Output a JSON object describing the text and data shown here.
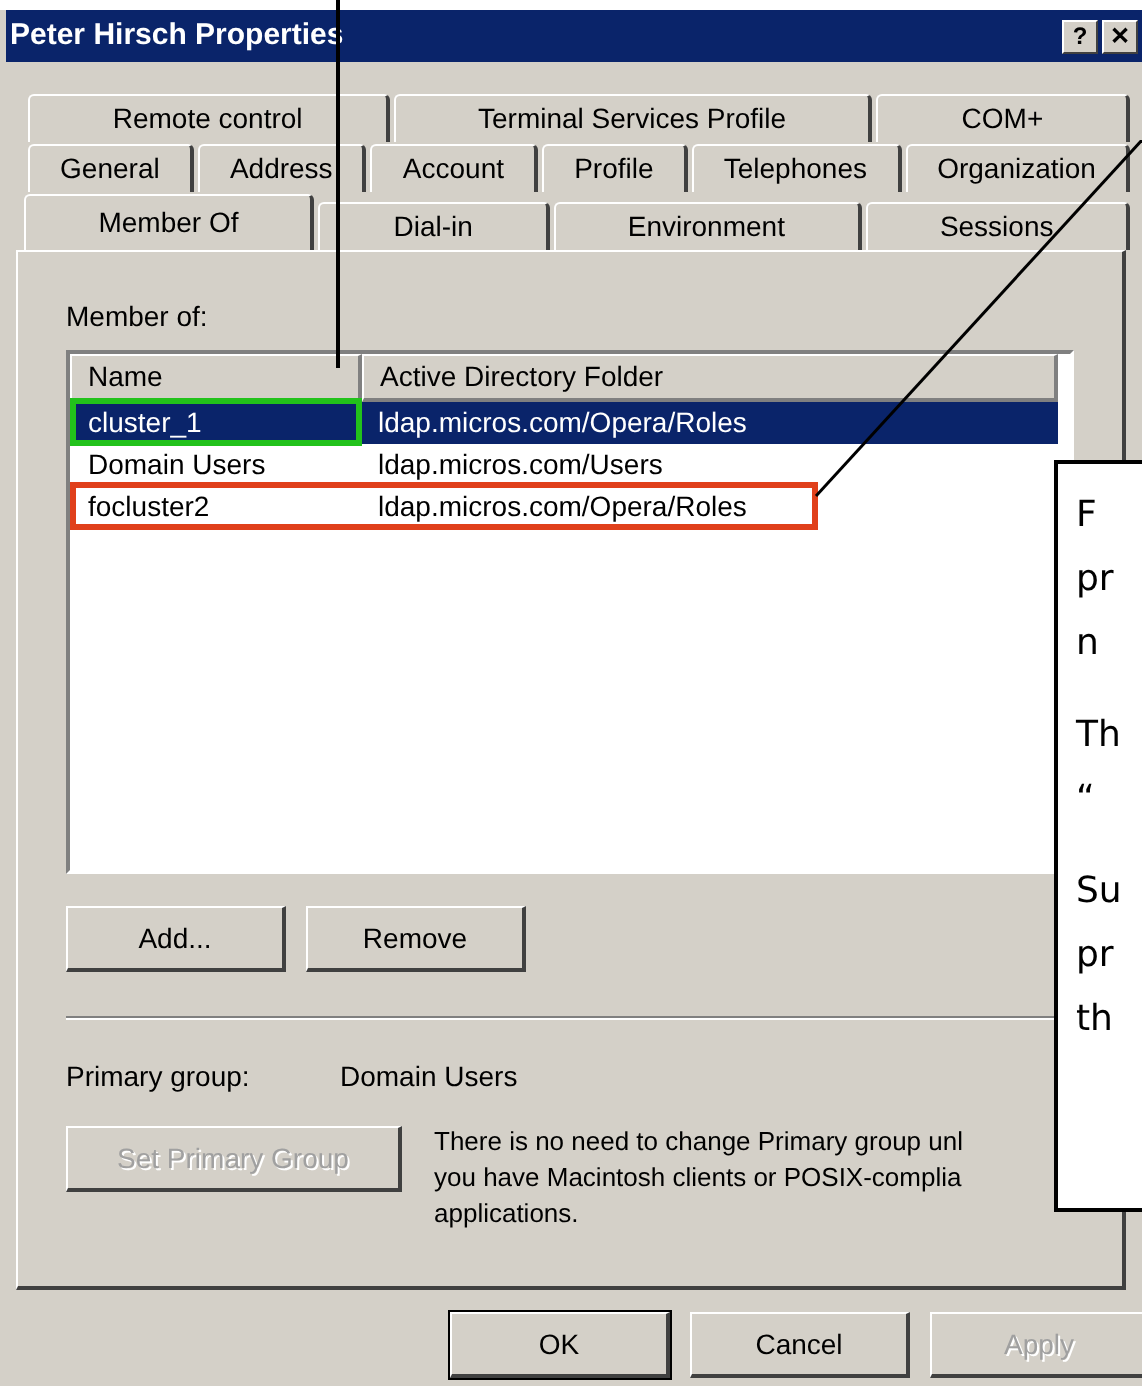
{
  "window": {
    "title": "Peter Hirsch Properties",
    "buttons": [
      "?",
      "✕"
    ]
  },
  "tab_rows": [
    [
      {
        "label": "Remote control",
        "selected": false
      },
      {
        "label": "Terminal Services Profile",
        "selected": false
      },
      {
        "label": "COM+",
        "selected": false
      }
    ],
    [
      {
        "label": "General",
        "selected": false
      },
      {
        "label": "Address",
        "selected": false
      },
      {
        "label": "Account",
        "selected": false
      },
      {
        "label": "Profile",
        "selected": false
      },
      {
        "label": "Telephones",
        "selected": false
      },
      {
        "label": "Organization",
        "selected": false
      }
    ],
    [
      {
        "label": "Member Of",
        "selected": true
      },
      {
        "label": "Dial-in",
        "selected": false
      },
      {
        "label": "Environment",
        "selected": false
      },
      {
        "label": "Sessions",
        "selected": false
      }
    ]
  ],
  "member_of": {
    "label": "Member of:",
    "columns": [
      "Name",
      "Active Directory Folder"
    ],
    "rows": [
      {
        "name": "cluster_1",
        "folder": "ldap.micros.com/Opera/Roles",
        "selected": true,
        "color": "#22c21b"
      },
      {
        "name": "Domain Users",
        "folder": "ldap.micros.com/Users",
        "selected": false
      },
      {
        "name": "focluster2",
        "folder": "ldap.micros.com/Opera/Roles",
        "selected": false,
        "color": "#e0401b"
      }
    ]
  },
  "list_buttons": [
    {
      "label": "Add...",
      "disabled": false
    },
    {
      "label": "Remove",
      "disabled": false
    }
  ],
  "primary_group": {
    "label": "Primary group:",
    "value": "Domain Users",
    "button": {
      "label": "Set Primary Group",
      "disabled": true
    },
    "note": [
      "There is no need to change Primary group unl",
      "you have Macintosh clients or POSIX-complia",
      "applications."
    ]
  },
  "dialog_buttons": [
    {
      "label": "OK",
      "disabled": false,
      "default": true
    },
    {
      "label": "Cancel",
      "disabled": false,
      "default": false
    },
    {
      "label": "Apply",
      "disabled": true,
      "default": false
    }
  ],
  "callout": {
    "paragraphs": [
      [
        "F",
        "pr",
        "n"
      ],
      [
        "Th",
        "“"
      ],
      [
        "Su",
        "pr",
        "th"
      ]
    ]
  }
}
